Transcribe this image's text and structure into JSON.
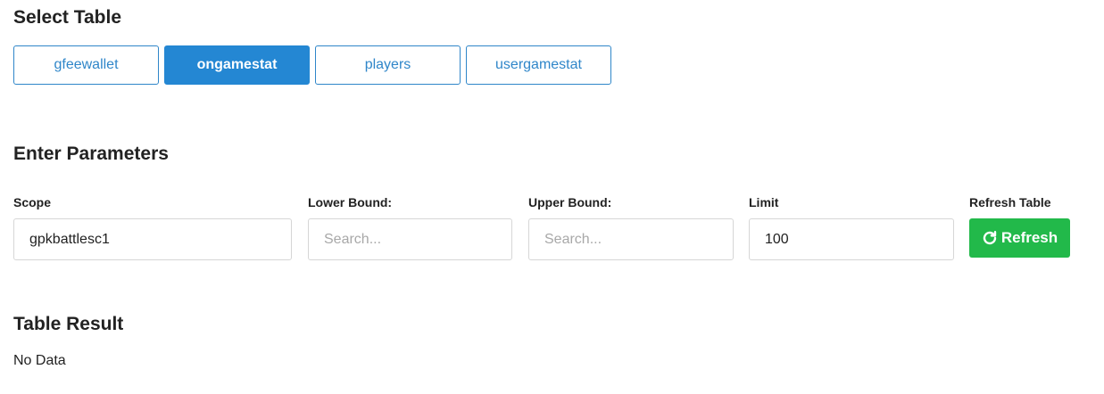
{
  "select_table": {
    "heading": "Select Table",
    "tables": [
      {
        "label": "gfeewallet",
        "active": false
      },
      {
        "label": "ongamestat",
        "active": true
      },
      {
        "label": "players",
        "active": false
      },
      {
        "label": "usergamestat",
        "active": false
      }
    ]
  },
  "parameters": {
    "heading": "Enter Parameters",
    "scope": {
      "label": "Scope",
      "value": "gpkbattlesc1"
    },
    "lower_bound": {
      "label": "Lower Bound:",
      "placeholder": "Search..."
    },
    "upper_bound": {
      "label": "Upper Bound:",
      "placeholder": "Search..."
    },
    "limit": {
      "label": "Limit",
      "value": "100"
    },
    "refresh": {
      "label": "Refresh Table",
      "button_label": "Refresh",
      "icon": "refresh-icon"
    }
  },
  "result": {
    "heading": "Table Result",
    "message": "No Data"
  },
  "colors": {
    "primary": "#2487d3",
    "success": "#22b94a"
  }
}
